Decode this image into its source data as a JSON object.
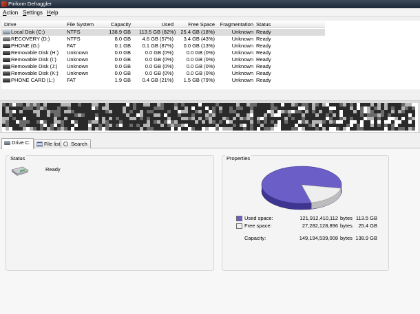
{
  "window": {
    "title": "Piriform Defraggler"
  },
  "menu": [
    {
      "acc": "A",
      "rest": "ction"
    },
    {
      "acc": "S",
      "rest": "ettings"
    },
    {
      "acc": "H",
      "rest": "elp"
    }
  ],
  "drive_list": {
    "columns": [
      "Drive",
      "File System",
      "Capacity",
      "Used",
      "Free Space",
      "Fragmentation",
      "Status"
    ],
    "rows": [
      {
        "drive": "Local Disk (C:)",
        "fs": "NTFS",
        "capacity": "138.9 GB",
        "used": "113.5 GB (82%)",
        "free": "25.4 GB (18%)",
        "frag": "Unknown",
        "status": "Ready",
        "icon": "local-disk-icon",
        "selected": true
      },
      {
        "drive": "RECOVERY (D:)",
        "fs": "NTFS",
        "capacity": "8.0 GB",
        "used": "4.6 GB (57%)",
        "free": "3.4 GB (43%)",
        "frag": "Unknown",
        "status": "Ready",
        "icon": "disk-icon",
        "selected": false
      },
      {
        "drive": "PHONE (G:)",
        "fs": "FAT",
        "capacity": "0.1 GB",
        "used": "0.1 GB (87%)",
        "free": "0.0 GB (13%)",
        "frag": "Unknown",
        "status": "Ready",
        "icon": "removable-disk-icon",
        "selected": false
      },
      {
        "drive": "Removable Disk (H:)",
        "fs": "Unknown",
        "capacity": "0.0 GB",
        "used": "0.0 GB (0%)",
        "free": "0.0 GB (0%)",
        "frag": "Unknown",
        "status": "Ready",
        "icon": "removable-disk-icon",
        "selected": false
      },
      {
        "drive": "Removable Disk (I:)",
        "fs": "Unknown",
        "capacity": "0.0 GB",
        "used": "0.0 GB (0%)",
        "free": "0.0 GB (0%)",
        "frag": "Unknown",
        "status": "Ready",
        "icon": "removable-disk-icon",
        "selected": false
      },
      {
        "drive": "Removable Disk (J:)",
        "fs": "Unknown",
        "capacity": "0.0 GB",
        "used": "0.0 GB (0%)",
        "free": "0.0 GB (0%)",
        "frag": "Unknown",
        "status": "Ready",
        "icon": "removable-disk-icon",
        "selected": false
      },
      {
        "drive": "Removable Disk (K:)",
        "fs": "Unknown",
        "capacity": "0.0 GB",
        "used": "0.0 GB (0%)",
        "free": "0.0 GB (0%)",
        "frag": "Unknown",
        "status": "Ready",
        "icon": "removable-disk-icon",
        "selected": false
      },
      {
        "drive": "PHONE CARD (L:)",
        "fs": "FAT",
        "capacity": "1.9 GB",
        "used": "0.4 GB (21%)",
        "free": "1.5 GB (79%)",
        "frag": "Unknown",
        "status": "Ready",
        "icon": "removable-disk-icon",
        "selected": false
      }
    ]
  },
  "tabs": [
    {
      "label": "Drive C:",
      "icon": "drive-icon",
      "active": true
    },
    {
      "label": "File list",
      "icon": "file-list-icon",
      "active": false
    },
    {
      "label": "Search",
      "icon": "search-icon",
      "active": false
    }
  ],
  "status_panel": {
    "title": "Status",
    "text": "Ready",
    "icon": "hard-drive-icon"
  },
  "properties_panel": {
    "title": "Properties",
    "used": {
      "label": "Used space:",
      "bytes": "121,912,410,112",
      "unit": "bytes",
      "size": "113.5 GB",
      "color": "#6b5fc7"
    },
    "free": {
      "label": "Free space:",
      "bytes": "27,282,128,896",
      "unit": "bytes",
      "size": "25.4 GB",
      "color": "#eeeeee"
    },
    "capacity": {
      "label": "Capacity:",
      "bytes": "149,194,539,008",
      "unit": "bytes",
      "size": "138.9 GB"
    },
    "used_fraction": 0.82
  },
  "colors": {
    "block_used": "#2a2a2a",
    "block_mid": "#6a6a6a",
    "block_light": "#b5b5b5",
    "block_free": "#ffffff"
  }
}
